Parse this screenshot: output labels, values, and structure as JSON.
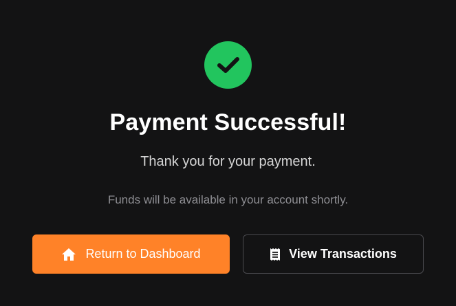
{
  "status": {
    "icon": "check-icon",
    "color": "#22c55e"
  },
  "title": "Payment Successful!",
  "message": "Thank you for your payment.",
  "note": "Funds will be available in your account shortly.",
  "actions": {
    "primary": {
      "label": "Return to Dashboard",
      "icon": "home-icon",
      "color": "#ff8228"
    },
    "secondary": {
      "label": "View Transactions",
      "icon": "receipt-icon"
    }
  }
}
